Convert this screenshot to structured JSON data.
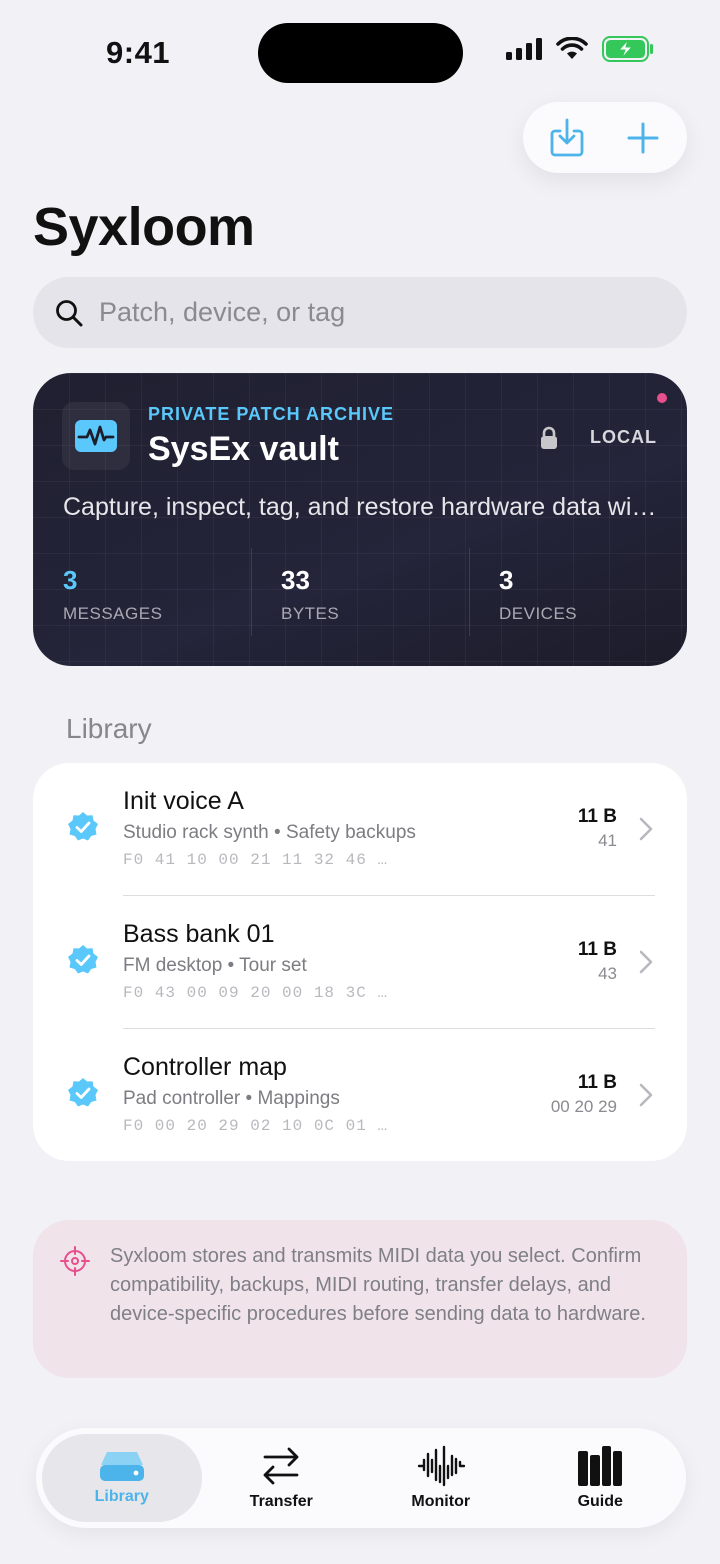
{
  "status_bar": {
    "time": "9:41"
  },
  "header": {
    "title": "Syxloom",
    "actions": [
      {
        "name": "import",
        "icon": "tray-arrow-down-icon"
      },
      {
        "name": "add",
        "icon": "plus-icon"
      }
    ]
  },
  "search": {
    "placeholder": "Patch, device, or tag",
    "value": ""
  },
  "vault": {
    "eyebrow": "PRIVATE PATCH ARCHIVE",
    "title": "SysEx vault",
    "badge": "LOCAL",
    "description": "Capture, inspect, tag, and restore hardware data wi…",
    "stats": [
      {
        "value": "3",
        "label": "MESSAGES"
      },
      {
        "value": "33",
        "label": "BYTES"
      },
      {
        "value": "3",
        "label": "DEVICES"
      }
    ]
  },
  "library": {
    "section_label": "Library",
    "items": [
      {
        "title": "Init voice A",
        "device": "Studio rack synth",
        "tag": "Safety backups",
        "hex": "F0 41 10 00 21 11 32 46 …",
        "size": "11 B",
        "meta": "41"
      },
      {
        "title": "Bass bank 01",
        "device": "FM desktop",
        "tag": "Tour set",
        "hex": "F0 43 00 09 20 00 18 3C …",
        "size": "11 B",
        "meta": "43"
      },
      {
        "title": "Controller map",
        "device": "Pad controller",
        "tag": "Mappings",
        "hex": "F0 00 20 29 02 10 0C 01 …",
        "size": "11 B",
        "meta": "00 20 29"
      }
    ]
  },
  "notice": {
    "text": "Syxloom stores and transmits MIDI data you select. Confirm compatibility, backups, MIDI routing, transfer delays, and device-specific procedures before sending data to hardware."
  },
  "tabs": [
    {
      "label": "Library",
      "icon": "drive-icon",
      "active": true
    },
    {
      "label": "Transfer",
      "icon": "arrows-left-right-icon",
      "active": false
    },
    {
      "label": "Monitor",
      "icon": "waveform-icon",
      "active": false
    },
    {
      "label": "Guide",
      "icon": "books-icon",
      "active": false
    }
  ],
  "colors": {
    "accent": "#5ac8fa",
    "background": "#f1f1f6",
    "vault_bg": "#1d1d2b",
    "notice_bg": "#f0e3ea",
    "notice_icon": "#e84f8d",
    "battery": "#34c759"
  }
}
